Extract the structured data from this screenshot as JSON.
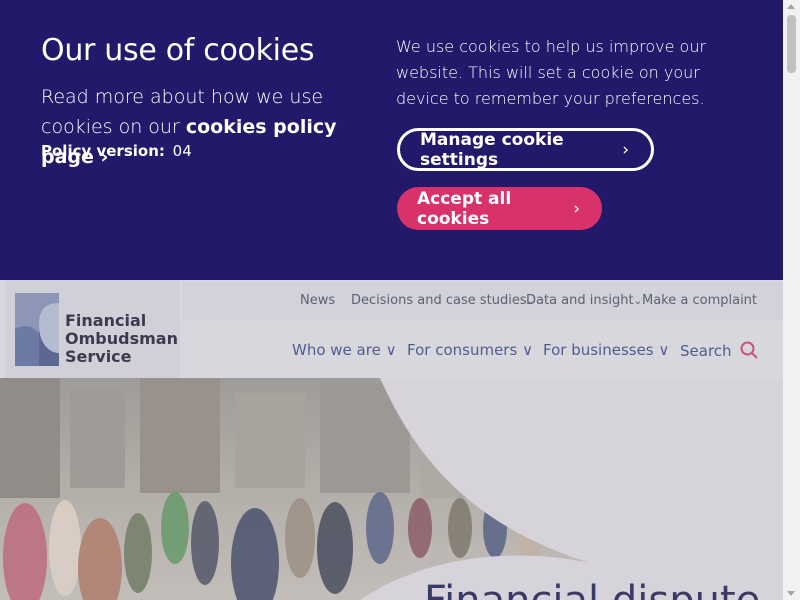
{
  "cookie_banner": {
    "title": "Our use of cookies",
    "read_more_prefix": "Read more about how we use cookies on our ",
    "policy_link": "cookies policy page",
    "policy_version_label": "Policy version:",
    "policy_version_value": "04",
    "description": "We use cookies to help us improve our website. This will set a cookie on your device to remember your preferences.",
    "manage_label": "Manage cookie settings",
    "accept_label": "Accept all cookies",
    "colors": {
      "background": "#23196b",
      "accent": "#d9326b"
    }
  },
  "logo": {
    "line1": "Financial",
    "line2": "Ombudsman",
    "line3": "Service"
  },
  "top_nav": [
    "News",
    "Decisions and case studies",
    "Data and insight",
    "Make a complaint"
  ],
  "main_nav": [
    "Who we are",
    "For consumers",
    "For businesses"
  ],
  "search_label": "Search",
  "hero": {
    "title": "Financial dispute"
  }
}
